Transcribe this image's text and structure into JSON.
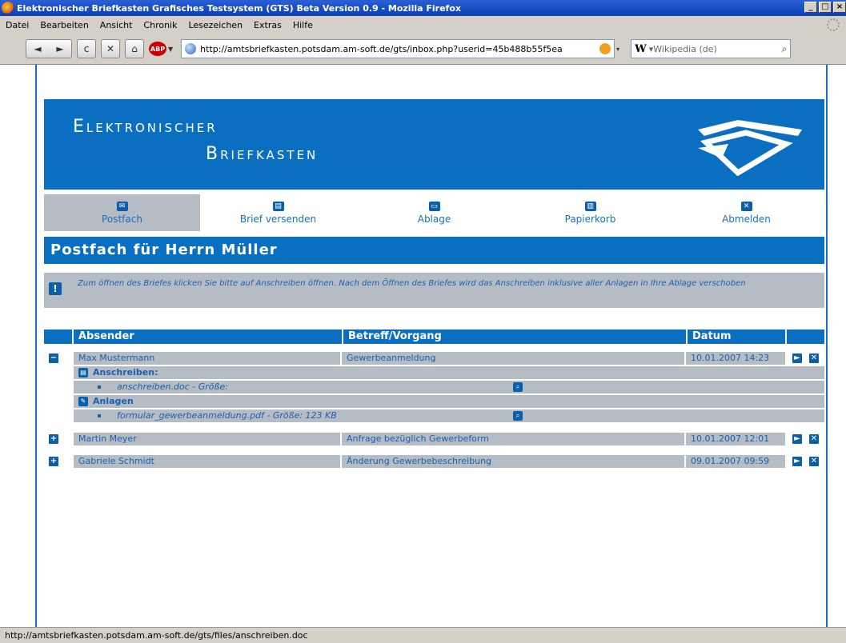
{
  "window": {
    "title": "Elektronischer Briefkasten Grafisches Testsystem (GTS) Beta Version 0.9 - Mozilla Firefox",
    "controls": [
      "_",
      "□",
      "×"
    ]
  },
  "menu": [
    "Datei",
    "Bearbeiten",
    "Ansicht",
    "Chronik",
    "Lesezeichen",
    "Extras",
    "Hilfe"
  ],
  "nav": {
    "back": "◄",
    "forward": "►",
    "reload": "c",
    "stop": "✕",
    "home": "⌂",
    "abp": "ABP",
    "url": "http://amtsbriefkasten.potsdam.am-soft.de/gts/inbox.php?userid=45b488b55f5ea",
    "search_engine": "W",
    "search_placeholder": "▾Wikipedia (de)",
    "magnifier": "🔍"
  },
  "banner": {
    "line1": "Elektronischer",
    "line2": "Briefkasten"
  },
  "tabs": [
    {
      "label": "Postfach",
      "icon": "✉"
    },
    {
      "label": "Brief versenden",
      "icon": "▤"
    },
    {
      "label": "Ablage",
      "icon": "▭"
    },
    {
      "label": "Papierkorb",
      "icon": "▥"
    },
    {
      "label": "Abmelden",
      "icon": "✕"
    }
  ],
  "section_title": "Postfach für Herrn Müller",
  "notice": {
    "icon": "!",
    "text": "Zum öffnen des Briefes klicken Sie bitte auf Anschreiben öffnen. Nach dem Öffnen des Briefes wird das Anschreiben inklusive aller Anlagen in Ihre Ablage verschoben"
  },
  "table": {
    "headers": {
      "sender": "Absender",
      "subject": "Betreff/Vorgang",
      "date": "Datum"
    },
    "rows": [
      {
        "toggle": "−",
        "sender": "Max Mustermann",
        "subject": "Gewerbeanmeldung",
        "date": "10.01.2007 14:23"
      },
      {
        "toggle": "+",
        "sender": "Martin Meyer",
        "subject": "Anfrage bezüglich Gewerbeform",
        "date": "10.01.2007 12:01"
      },
      {
        "toggle": "+",
        "sender": "Gabriele Schmidt",
        "subject": "Änderung Gewerbebeschreibung",
        "date": "09.01.2007 09:59"
      }
    ],
    "expanded": {
      "cover_label": "Anschreiben:",
      "cover_file": "anschreiben.doc - Größe:",
      "attach_label": "Anlagen",
      "attach_file": "formular_gewerbeanmeldung.pdf - Größe: 123 KB"
    },
    "open_icon": "►",
    "delete_icon": "✕"
  },
  "statusbar": "http://amtsbriefkasten.potsdam.am-soft.de/gts/files/anschreiben.doc"
}
